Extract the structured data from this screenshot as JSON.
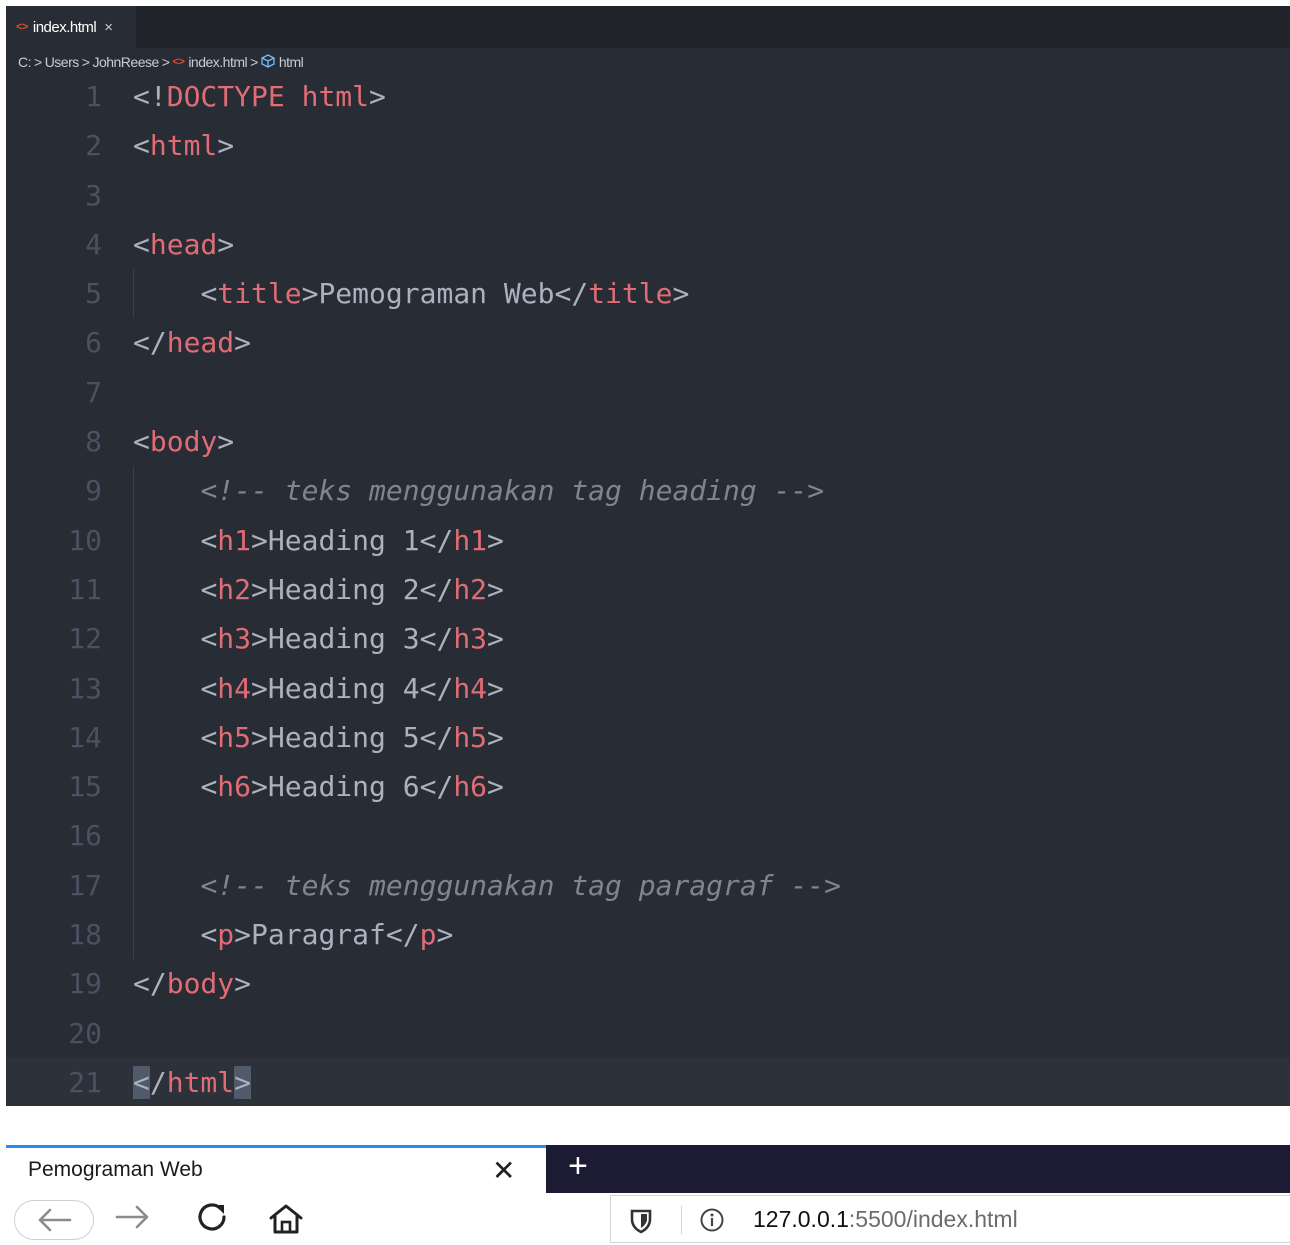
{
  "editor": {
    "tab": {
      "label": "index.html",
      "close": "×"
    },
    "breadcrumb": {
      "drive": "C:",
      "users": "Users",
      "user": "JohnReese",
      "file": "index.html",
      "node": "html",
      "sep": ">"
    },
    "lines": [
      {
        "n": "1",
        "tokens": [
          [
            "punct",
            "<!"
          ],
          [
            "tag",
            "DOCTYPE"
          ],
          [
            "txt",
            " "
          ],
          [
            "tag",
            "html"
          ],
          [
            "punct",
            ">"
          ]
        ]
      },
      {
        "n": "2",
        "tokens": [
          [
            "punct",
            "<"
          ],
          [
            "tag",
            "html"
          ],
          [
            "punct",
            ">"
          ]
        ]
      },
      {
        "n": "3",
        "tokens": []
      },
      {
        "n": "4",
        "tokens": [
          [
            "punct",
            "<"
          ],
          [
            "tag",
            "head"
          ],
          [
            "punct",
            ">"
          ]
        ]
      },
      {
        "n": "5",
        "guide": true,
        "tokens": [
          [
            "txt",
            "    "
          ],
          [
            "punct",
            "<"
          ],
          [
            "tag",
            "title"
          ],
          [
            "punct",
            ">"
          ],
          [
            "txt",
            "Pemograman Web"
          ],
          [
            "punct",
            "</"
          ],
          [
            "tag",
            "title"
          ],
          [
            "punct",
            ">"
          ]
        ]
      },
      {
        "n": "6",
        "tokens": [
          [
            "punct",
            "</"
          ],
          [
            "tag",
            "head"
          ],
          [
            "punct",
            ">"
          ]
        ]
      },
      {
        "n": "7",
        "tokens": []
      },
      {
        "n": "8",
        "tokens": [
          [
            "punct",
            "<"
          ],
          [
            "tag",
            "body"
          ],
          [
            "punct",
            ">"
          ]
        ]
      },
      {
        "n": "9",
        "guide": true,
        "tokens": [
          [
            "txt",
            "    "
          ],
          [
            "cmt",
            "<!-- teks menggunakan tag heading -->"
          ]
        ]
      },
      {
        "n": "10",
        "guide": true,
        "tokens": [
          [
            "txt",
            "    "
          ],
          [
            "punct",
            "<"
          ],
          [
            "tag",
            "h1"
          ],
          [
            "punct",
            ">"
          ],
          [
            "txt",
            "Heading 1"
          ],
          [
            "punct",
            "</"
          ],
          [
            "tag",
            "h1"
          ],
          [
            "punct",
            ">"
          ]
        ]
      },
      {
        "n": "11",
        "guide": true,
        "tokens": [
          [
            "txt",
            "    "
          ],
          [
            "punct",
            "<"
          ],
          [
            "tag",
            "h2"
          ],
          [
            "punct",
            ">"
          ],
          [
            "txt",
            "Heading 2"
          ],
          [
            "punct",
            "</"
          ],
          [
            "tag",
            "h2"
          ],
          [
            "punct",
            ">"
          ]
        ]
      },
      {
        "n": "12",
        "guide": true,
        "tokens": [
          [
            "txt",
            "    "
          ],
          [
            "punct",
            "<"
          ],
          [
            "tag",
            "h3"
          ],
          [
            "punct",
            ">"
          ],
          [
            "txt",
            "Heading 3"
          ],
          [
            "punct",
            "</"
          ],
          [
            "tag",
            "h3"
          ],
          [
            "punct",
            ">"
          ]
        ]
      },
      {
        "n": "13",
        "guide": true,
        "tokens": [
          [
            "txt",
            "    "
          ],
          [
            "punct",
            "<"
          ],
          [
            "tag",
            "h4"
          ],
          [
            "punct",
            ">"
          ],
          [
            "txt",
            "Heading 4"
          ],
          [
            "punct",
            "</"
          ],
          [
            "tag",
            "h4"
          ],
          [
            "punct",
            ">"
          ]
        ]
      },
      {
        "n": "14",
        "guide": true,
        "tokens": [
          [
            "txt",
            "    "
          ],
          [
            "punct",
            "<"
          ],
          [
            "tag",
            "h5"
          ],
          [
            "punct",
            ">"
          ],
          [
            "txt",
            "Heading 5"
          ],
          [
            "punct",
            "</"
          ],
          [
            "tag",
            "h5"
          ],
          [
            "punct",
            ">"
          ]
        ]
      },
      {
        "n": "15",
        "guide": true,
        "tokens": [
          [
            "txt",
            "    "
          ],
          [
            "punct",
            "<"
          ],
          [
            "tag",
            "h6"
          ],
          [
            "punct",
            ">"
          ],
          [
            "txt",
            "Heading 6"
          ],
          [
            "punct",
            "</"
          ],
          [
            "tag",
            "h6"
          ],
          [
            "punct",
            ">"
          ]
        ]
      },
      {
        "n": "16",
        "guide": true,
        "tokens": []
      },
      {
        "n": "17",
        "guide": true,
        "tokens": [
          [
            "txt",
            "    "
          ],
          [
            "cmt",
            "<!-- teks menggunakan tag paragraf -->"
          ]
        ]
      },
      {
        "n": "18",
        "guide": true,
        "tokens": [
          [
            "txt",
            "    "
          ],
          [
            "punct",
            "<"
          ],
          [
            "tag",
            "p"
          ],
          [
            "punct",
            ">"
          ],
          [
            "txt",
            "Paragraf"
          ],
          [
            "punct",
            "</"
          ],
          [
            "tag",
            "p"
          ],
          [
            "punct",
            ">"
          ]
        ]
      },
      {
        "n": "19",
        "tokens": [
          [
            "punct",
            "</"
          ],
          [
            "tag",
            "body"
          ],
          [
            "punct",
            ">"
          ]
        ]
      },
      {
        "n": "20",
        "tokens": []
      },
      {
        "n": "21",
        "active": true,
        "tokens": [
          [
            "hl",
            "<"
          ],
          [
            "punct",
            "/"
          ],
          [
            "tag",
            "html"
          ],
          [
            "hl",
            ">"
          ]
        ]
      }
    ]
  },
  "browser": {
    "tab_title": "Pemograman Web",
    "tab_close": "✕",
    "new_tab": "+",
    "url_host": "127.0.0.1",
    "url_rest": ":5500/index.html"
  },
  "colors": {
    "editor_bg": "#282c34",
    "tag": "#e06c75",
    "text": "#abb2bf",
    "comment": "#7f848e",
    "line_number": "#495162",
    "browser_tabbar": "#1c1b33",
    "browser_accent": "#2a8cf2"
  },
  "icons": [
    "html-file-icon",
    "close-icon",
    "cube-icon",
    "back-arrow-icon",
    "forward-arrow-icon",
    "reload-icon",
    "home-icon",
    "shield-icon",
    "info-icon",
    "plus-icon"
  ]
}
